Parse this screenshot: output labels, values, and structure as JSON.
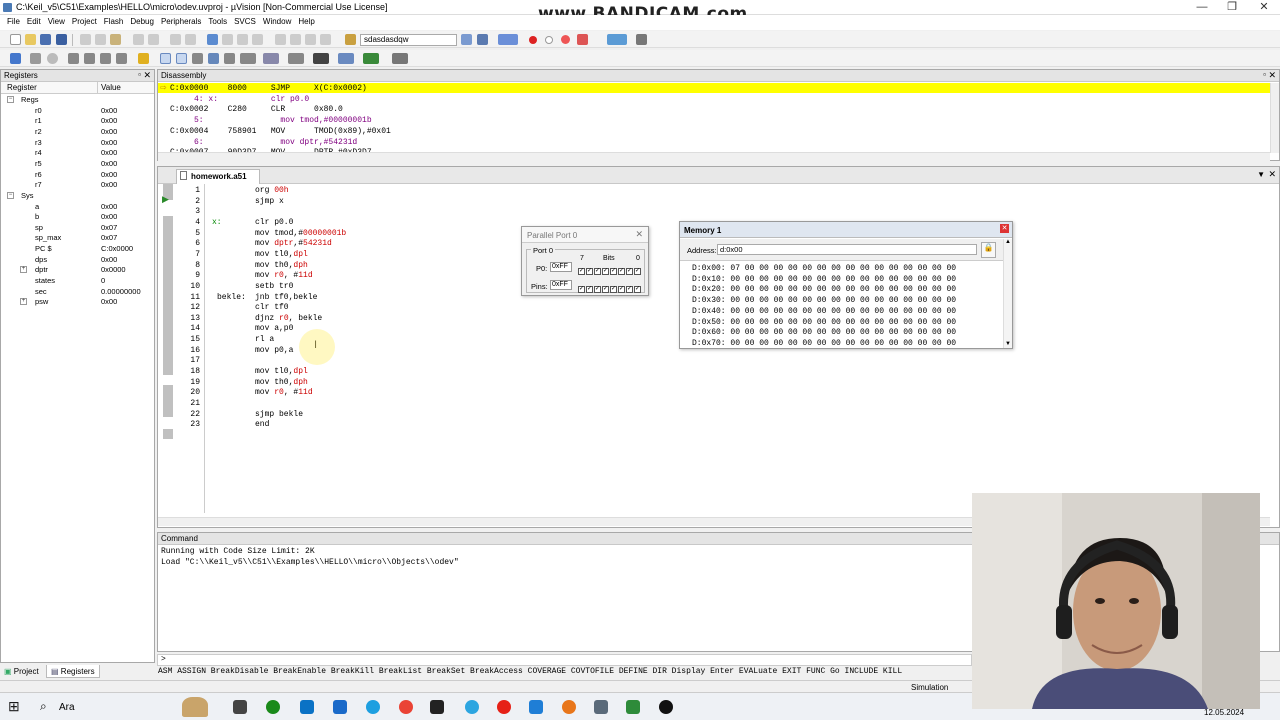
{
  "window": {
    "title": "C:\\Keil_v5\\C51\\Examples\\HELLO\\micro\\odev.uvproj - µVision  [Non-Commercial Use License]",
    "watermark": "www.BANDICAM.com",
    "controls": [
      "—",
      "❐",
      "✕"
    ]
  },
  "menu": [
    "File",
    "Edit",
    "View",
    "Project",
    "Flash",
    "Debug",
    "Peripherals",
    "Tools",
    "SVCS",
    "Window",
    "Help"
  ],
  "toolbar": {
    "find_text": "sdasdasdqw"
  },
  "registers": {
    "title": "Registers",
    "col_register": "Register",
    "col_value": "Value",
    "rows": [
      {
        "name": "Regs",
        "value": "",
        "indent": 0,
        "expander": "−"
      },
      {
        "name": "r0",
        "value": "0x00",
        "indent": 2
      },
      {
        "name": "r1",
        "value": "0x00",
        "indent": 2
      },
      {
        "name": "r2",
        "value": "0x00",
        "indent": 2
      },
      {
        "name": "r3",
        "value": "0x00",
        "indent": 2
      },
      {
        "name": "r4",
        "value": "0x00",
        "indent": 2
      },
      {
        "name": "r5",
        "value": "0x00",
        "indent": 2
      },
      {
        "name": "r6",
        "value": "0x00",
        "indent": 2
      },
      {
        "name": "r7",
        "value": "0x00",
        "indent": 2
      },
      {
        "name": "Sys",
        "value": "",
        "indent": 0,
        "expander": "−"
      },
      {
        "name": "a",
        "value": "0x00",
        "indent": 2
      },
      {
        "name": "b",
        "value": "0x00",
        "indent": 2
      },
      {
        "name": "sp",
        "value": "0x07",
        "indent": 2
      },
      {
        "name": "sp_max",
        "value": "0x07",
        "indent": 2
      },
      {
        "name": "PC  $",
        "value": "C:0x0000",
        "indent": 2
      },
      {
        "name": "dps",
        "value": "0x00",
        "indent": 2
      },
      {
        "name": "dptr",
        "value": "0x0000",
        "indent": 2,
        "expander": "+"
      },
      {
        "name": "states",
        "value": "0",
        "indent": 2
      },
      {
        "name": "sec",
        "value": "0.00000000",
        "indent": 2
      },
      {
        "name": "psw",
        "value": "0x00",
        "indent": 2,
        "expander": "+"
      }
    ],
    "tabs": [
      "Project",
      "Registers"
    ]
  },
  "disassembly": {
    "title": "Disassembly",
    "lines": [
      "C:0x0000    8000     SJMP     X(C:0x0002)",
      "     4: x:           clr p0.0",
      "C:0x0002    C280     CLR      0x80.0",
      "     5:                mov tmod,#00000001b",
      "C:0x0004    758901   MOV      TMOD(0x89),#0x01",
      "     6:                mov dptr,#54231d",
      "C:0x0007    90D3D7   MOV      DPTR,#0xD3D7"
    ]
  },
  "editor": {
    "tab": "homework.a51",
    "lines": [
      {
        "n": "1",
        "label": "",
        "code": [
          [
            "org ",
            "kw"
          ],
          [
            "00h",
            "num"
          ]
        ]
      },
      {
        "n": "2",
        "label": "",
        "code": [
          [
            "sjmp x",
            "kw"
          ]
        ]
      },
      {
        "n": "3",
        "label": "",
        "code": []
      },
      {
        "n": "4",
        "label": "x:",
        "code": [
          [
            "clr p0.0",
            "kw"
          ]
        ]
      },
      {
        "n": "5",
        "label": "",
        "code": [
          [
            "mov tmod,#",
            "kw"
          ],
          [
            "00000001b",
            "num"
          ]
        ]
      },
      {
        "n": "6",
        "label": "",
        "code": [
          [
            "mov ",
            "kw"
          ],
          [
            "dptr",
            "num"
          ],
          [
            ",#",
            "kw"
          ],
          [
            "54231d",
            "num"
          ]
        ]
      },
      {
        "n": "7",
        "label": "",
        "code": [
          [
            "mov tl0,",
            "kw"
          ],
          [
            "dpl",
            "num"
          ]
        ]
      },
      {
        "n": "8",
        "label": "",
        "code": [
          [
            "mov th0,",
            "kw"
          ],
          [
            "dph",
            "num"
          ]
        ]
      },
      {
        "n": "9",
        "label": "",
        "code": [
          [
            "mov ",
            "kw"
          ],
          [
            "r0",
            "num"
          ],
          [
            ", #",
            "kw"
          ],
          [
            "11d",
            "num"
          ]
        ]
      },
      {
        "n": "10",
        "label": "",
        "code": [
          [
            "setb tr0",
            "kw"
          ]
        ]
      },
      {
        "n": "11",
        "label": "bekle:",
        "code": [
          [
            "jnb tf0,bekle",
            "kw"
          ]
        ]
      },
      {
        "n": "12",
        "label": "",
        "code": [
          [
            "clr tf0",
            "kw"
          ]
        ]
      },
      {
        "n": "13",
        "label": "",
        "code": [
          [
            "djnz ",
            "kw"
          ],
          [
            "r0",
            "num"
          ],
          [
            ", bekle",
            "kw"
          ]
        ]
      },
      {
        "n": "14",
        "label": "",
        "code": [
          [
            "mov a,p0",
            "kw"
          ]
        ]
      },
      {
        "n": "15",
        "label": "",
        "code": [
          [
            "rl a",
            "kw"
          ]
        ]
      },
      {
        "n": "16",
        "label": "",
        "code": [
          [
            "mov p0,a",
            "kw"
          ]
        ]
      },
      {
        "n": "17",
        "label": "",
        "code": []
      },
      {
        "n": "18",
        "label": "",
        "code": [
          [
            "mov tl0,",
            "kw"
          ],
          [
            "dpl",
            "num"
          ]
        ]
      },
      {
        "n": "19",
        "label": "",
        "code": [
          [
            "mov th0,",
            "kw"
          ],
          [
            "dph",
            "num"
          ]
        ]
      },
      {
        "n": "20",
        "label": "",
        "code": [
          [
            "mov ",
            "kw"
          ],
          [
            "r0",
            "num"
          ],
          [
            ", #",
            "kw"
          ],
          [
            "11d",
            "num"
          ]
        ]
      },
      {
        "n": "21",
        "label": "",
        "code": []
      },
      {
        "n": "22",
        "label": "",
        "code": [
          [
            "sjmp bekle",
            "kw"
          ]
        ]
      },
      {
        "n": "23",
        "label": "",
        "code": [
          [
            "end",
            "kw"
          ]
        ]
      }
    ]
  },
  "parallel_port": {
    "title": "Parallel Port 0",
    "group": "Port 0",
    "bits_label": "Bits",
    "bit_hi": "7",
    "bit_lo": "0",
    "p0_label": "P0:",
    "p0_value": "0xFF",
    "pins_label": "Pins:",
    "pins_value": "0xFF"
  },
  "memory": {
    "title": "Memory 1",
    "address_label": "Address:",
    "address_value": "d:0x00",
    "rows": [
      "D:0x00: 07 00 00 00 00 00 00 00 00 00 00 00 00 00 00 00",
      "D:0x10: 00 00 00 00 00 00 00 00 00 00 00 00 00 00 00 00",
      "D:0x20: 00 00 00 00 00 00 00 00 00 00 00 00 00 00 00 00",
      "D:0x30: 00 00 00 00 00 00 00 00 00 00 00 00 00 00 00 00",
      "D:0x40: 00 00 00 00 00 00 00 00 00 00 00 00 00 00 00 00",
      "D:0x50: 00 00 00 00 00 00 00 00 00 00 00 00 00 00 00 00",
      "D:0x60: 00 00 00 00 00 00 00 00 00 00 00 00 00 00 00 00",
      "D:0x70: 00 00 00 00 00 00 00 00 00 00 00 00 00 00 00 00"
    ]
  },
  "command": {
    "title": "Command",
    "lines": [
      "Running with Code Size Limit: 2K",
      "Load \"C:\\\\Keil_v5\\\\C51\\\\Examples\\\\HELLO\\\\micro\\\\Objects\\\\odev\""
    ],
    "prompt": ">",
    "help": "ASM ASSIGN BreakDisable BreakEnable BreakKill BreakList BreakSet BreakAccess COVERAGE COVTOFILE DEFINE DIR Display Enter EVALuate EXIT FUNC Go INCLUDE KILL"
  },
  "status": {
    "mode": "Simulation"
  },
  "taskbar": {
    "search": "Ara",
    "date": "12.05.2024"
  },
  "colors": {
    "current_line": "#ffff00",
    "code_number": "#cc0000",
    "label_green": "#008800"
  }
}
